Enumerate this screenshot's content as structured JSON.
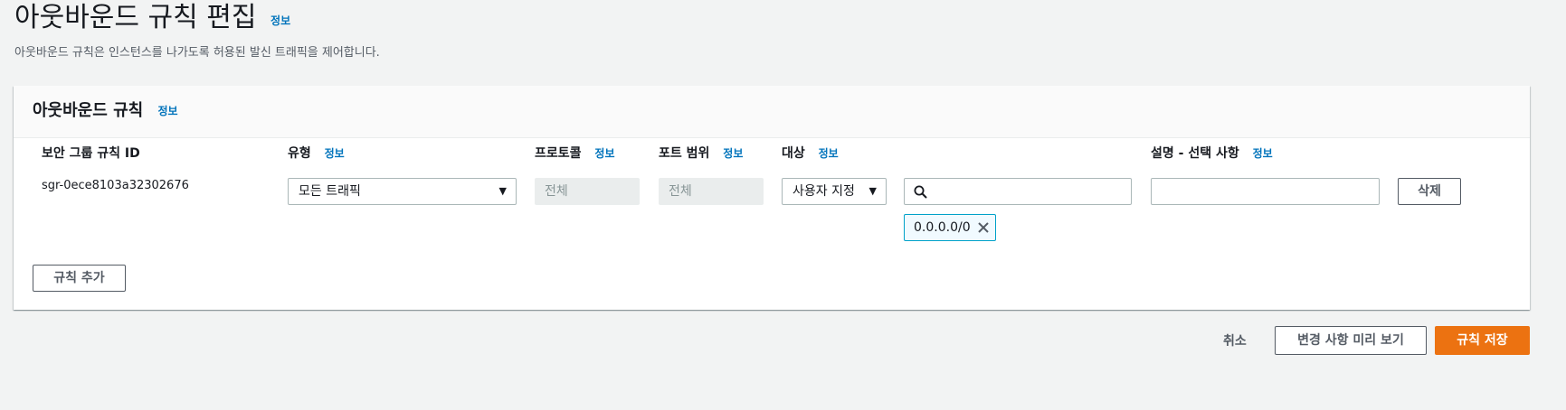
{
  "page": {
    "title": "아웃바운드 규칙 편집",
    "title_info": "정보",
    "description": "아웃바운드 규칙은 인스턴스를 나가도록 허용된 발신 트래픽을 제어합니다."
  },
  "panel": {
    "title": "아웃바운드 규칙",
    "title_info": "정보",
    "columns": {
      "sg_rule_id": "보안 그룹 규칙 ID",
      "type": "유형",
      "protocol": "프로토콜",
      "port_range": "포트 범위",
      "destination": "대상",
      "description": "설명 - 선택 사항",
      "info": "정보"
    },
    "rule": {
      "id": "sgr-0ece8103a32302676",
      "type_value": "모든 트래픽",
      "protocol_value": "전체",
      "port_value": "전체",
      "destination_type": "사용자 지정",
      "search_value": "",
      "description_value": "",
      "cidr_token": "0.0.0.0/0",
      "delete_label": "삭제"
    },
    "add_rule_label": "규칙 추가"
  },
  "footer": {
    "cancel_label": "취소",
    "preview_label": "변경 사항 미리 보기",
    "save_label": "규칙 저장"
  },
  "colors": {
    "accent": "#0073bb",
    "primary": "#ec7211",
    "token_border": "#00a1c9"
  }
}
